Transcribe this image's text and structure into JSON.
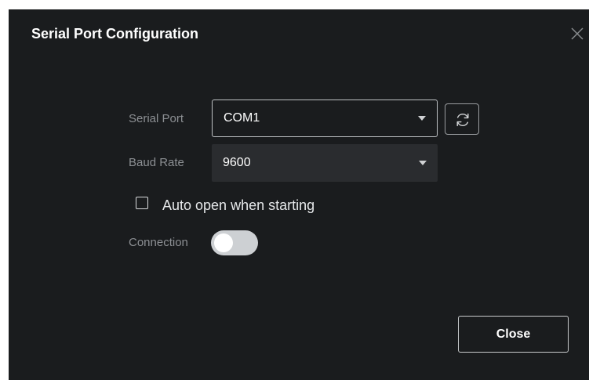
{
  "dialog": {
    "title": "Serial Port Configuration",
    "close_icon": "close-x-icon"
  },
  "serial_port": {
    "label": "Serial Port",
    "value": "COM1",
    "refresh_icon": "refresh-icon"
  },
  "baud_rate": {
    "label": "Baud Rate",
    "value": "9600"
  },
  "auto_open": {
    "label": "Auto open when starting",
    "checked": false
  },
  "connection": {
    "label": "Connection",
    "enabled": false
  },
  "footer": {
    "close_label": "Close"
  },
  "colors": {
    "dialog_bg": "#1a1c1e",
    "field_bg": "#2a2c2f",
    "label": "#8c8f93",
    "toggle_off": "#cdd0d3"
  }
}
